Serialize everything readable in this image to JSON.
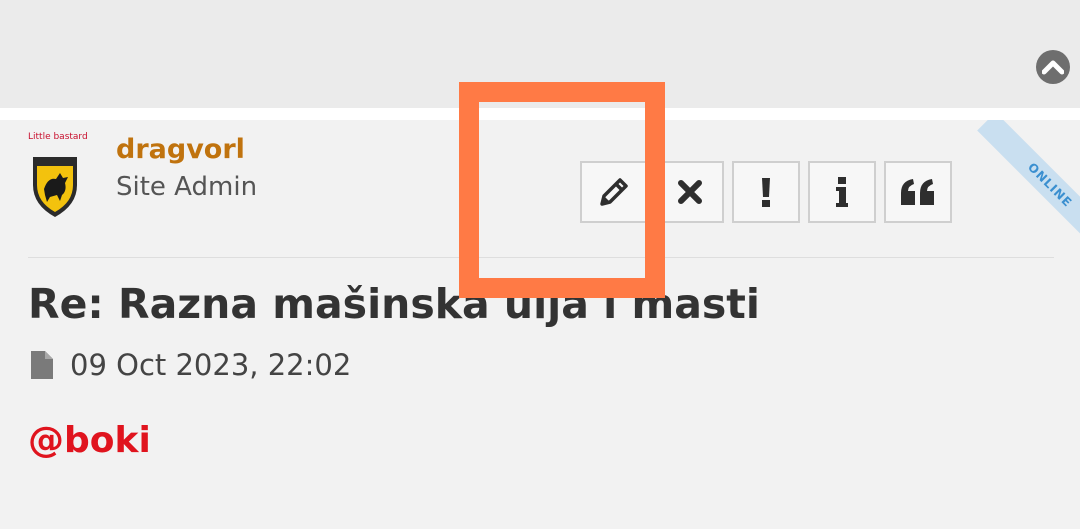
{
  "post": {
    "author": {
      "rank_title": "Little bastard",
      "username": "dragvorl",
      "rank": "Site Admin",
      "avatar_icon": "bull-shield-avatar"
    },
    "online_label": "ONLINE",
    "actions": [
      {
        "name": "edit",
        "icon": "pencil-icon"
      },
      {
        "name": "delete",
        "icon": "close-icon"
      },
      {
        "name": "report",
        "icon": "exclamation-icon"
      },
      {
        "name": "info",
        "icon": "info-icon"
      },
      {
        "name": "quote",
        "icon": "quote-icon"
      }
    ],
    "title": "Re: Razna mašinska ulja i masti",
    "date": "09 Oct 2023, 22:02",
    "body": "@boki"
  },
  "colors": {
    "username": "#c0730e",
    "rank_title": "#c8102e",
    "body_text": "#e0141e",
    "highlight": "#ff7a45",
    "online_ribbon": "#c9dff0"
  }
}
